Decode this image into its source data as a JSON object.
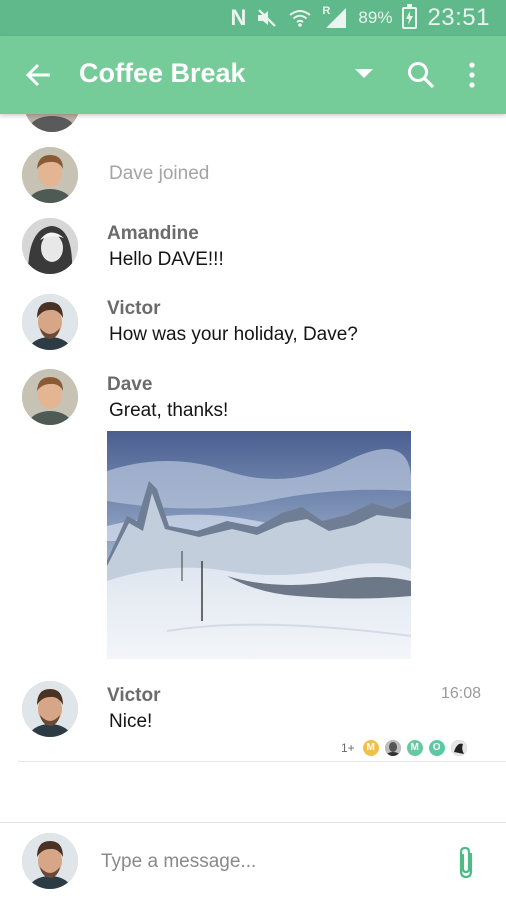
{
  "status_bar": {
    "n_icon": "N",
    "roaming": "R",
    "battery": "89%",
    "time": "23:51"
  },
  "app_bar": {
    "title": "Coffee Break",
    "icons": [
      "back-arrow-icon",
      "dropdown-icon",
      "search-icon",
      "more-vert-icon"
    ]
  },
  "messages": [
    {
      "type": "system",
      "text": "Dave joined"
    },
    {
      "sender": "Amandine",
      "text": "Hello DAVE!!!"
    },
    {
      "sender": "Victor",
      "text": "How was your holiday, Dave?"
    },
    {
      "sender": "Dave",
      "text": "Great, thanks!",
      "attachment": "mountain-photo"
    },
    {
      "sender": "Victor",
      "text": "Nice!",
      "time": "16:08"
    }
  ],
  "read_receipts": {
    "count": "1+",
    "avatars": [
      {
        "initial": "M",
        "color": "#f0c04a"
      },
      {
        "initial": "",
        "color": "#8d8d8d"
      },
      {
        "initial": "M",
        "color": "#66c9a2"
      },
      {
        "initial": "O",
        "color": "#5cc9a0"
      },
      {
        "initial": "",
        "color": "#7a7a7a"
      }
    ]
  },
  "composer": {
    "placeholder": "Type a message..."
  },
  "colors": {
    "status_bar": "#5fb98a",
    "app_bar": "#76cc99",
    "accent": "#4dbb85"
  }
}
